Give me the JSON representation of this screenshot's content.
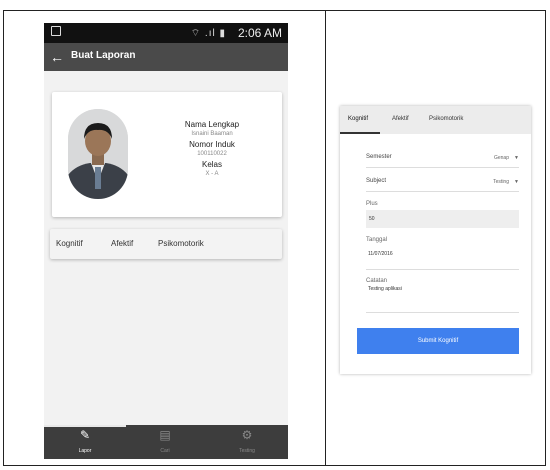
{
  "status_bar": {
    "time": "2:06 AM",
    "signal_icons": "⌔ .ıl ▮"
  },
  "app_bar": {
    "back_icon": "←",
    "title": "Buat Laporan"
  },
  "profile": {
    "name_label": "Nama Lengkap",
    "name_value": "Isnaini Baaman",
    "nis_label": "Nomor Induk",
    "nis_value": "100110022",
    "class_label": "Kelas",
    "class_value": "X - A"
  },
  "tabs": [
    "Kognitif",
    "Afektif",
    "Psikomotorik"
  ],
  "bottom_nav": [
    {
      "icon": "✎",
      "label": "Lapor",
      "active": true
    },
    {
      "icon": "▤",
      "label": "Cari",
      "active": false
    },
    {
      "icon": "⚙",
      "label": "Testing",
      "active": false
    }
  ],
  "form": {
    "tabs": [
      "Kognitif",
      "Afektif",
      "Psikomotorik"
    ],
    "semester_label": "Semester",
    "semester_value": "Genap",
    "subject_label": "Subject",
    "subject_value": "Testing",
    "plus_label": "Plus",
    "plus_value": "50",
    "tanggal_label": "Tanggal",
    "tanggal_value": "11/07/2016",
    "catatan_label": "Catatan",
    "catatan_value": "Testing aplikasi",
    "submit_label": "Submit Kognitif",
    "dropdown_icon": "▼"
  },
  "colors": {
    "accent": "#3f80ee",
    "appbar": "#4a4a4a",
    "bottom_nav": "#3d3d3d"
  }
}
